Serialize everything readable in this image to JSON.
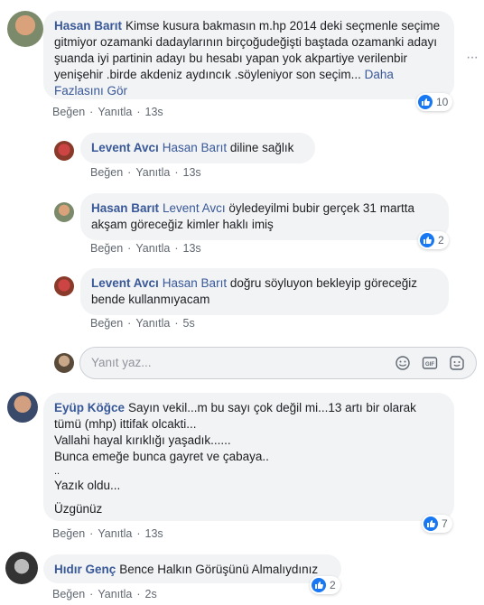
{
  "comments": [
    {
      "author": "Hasan Barıt",
      "text": "Kimse kusura bakmasın m.hp 2014 deki seçmenle seçime gitmiyor ozamanki dadaylarının birçoğudeğişti baştada ozamanki adayı şuanda iyi partinin adayı bu hesabı yapan yok akpartiye verilenbir yenişehir .birde akdeniz aydıncık .söyleniyor son seçim...",
      "more_link": "Daha Fazlasını Gör",
      "like": "Beğen",
      "reply": "Yanıtla",
      "time": "13s",
      "reactions": "10"
    },
    {
      "author": "Levent Avcı",
      "tag": "Hasan Barıt",
      "text": "diline sağlık",
      "like": "Beğen",
      "reply": "Yanıtla",
      "time": "13s"
    },
    {
      "author": "Hasan Barıt",
      "tag": "Levent Avcı",
      "text": "öyledeyilmi bubir gerçek 31 martta akşam göreceğiz kimler haklı imiş",
      "like": "Beğen",
      "reply": "Yanıtla",
      "time": "13s",
      "reactions": "2"
    },
    {
      "author": "Levent Avcı",
      "tag": "Hasan Barıt",
      "text": "doğru söyluyon bekleyip göreceğiz bende kullanmıyacam",
      "like": "Beğen",
      "reply": "Yanıtla",
      "time": "5s"
    },
    {
      "author": "Eyüp Köğce",
      "line1": "Sayın vekil...m bu sayı çok değil mi...13 artı bir olarak tümü (mhp) ittifak olcakti...",
      "line2": "Vallahi hayal kırıklığı yaşadık......",
      "line3": "Bunca emeğe bunca gayret ve çabaya..",
      "line4": "..",
      "line5": "Yazık oldu...",
      "line6": "Üzgünüz",
      "like": "Beğen",
      "reply": "Yanıtla",
      "time": "13s",
      "reactions": "7"
    },
    {
      "author": "Hıdır Genç",
      "text": "Bence Halkın Görüşünü Almalıydınız",
      "like": "Beğen",
      "reply": "Yanıtla",
      "time": "2s",
      "reactions": "2"
    }
  ],
  "reply_box": {
    "placeholder": "Yanıt yaz..."
  },
  "colors": {
    "link": "#385898",
    "bubble": "#f2f3f5",
    "like_blue": "#1877f2"
  }
}
